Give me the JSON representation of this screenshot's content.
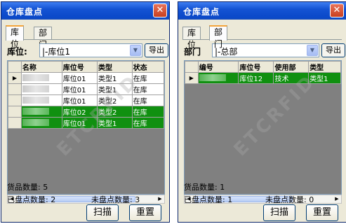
{
  "left": {
    "title": "仓库盘点",
    "close": "✕",
    "tabs": [
      "库位",
      "部门"
    ],
    "filter_label": "库位:",
    "combo_value": "|-库位1",
    "export": "导出",
    "columns": [
      "名称",
      "库位号",
      "类型",
      "状态"
    ],
    "rows": [
      {
        "loc": "库位01",
        "type": "类型1",
        "status": "在库"
      },
      {
        "loc": "库位01",
        "type": "类型1",
        "status": "在库"
      },
      {
        "loc": "库位01",
        "type": "类型2",
        "status": "在库"
      },
      {
        "loc": "库位02",
        "type": "类型2",
        "status": "在库"
      },
      {
        "loc": "库位01",
        "type": "类型1",
        "status": "在库"
      }
    ],
    "goods_count": "货品数量: 5",
    "checked": "已盘点数量: 2",
    "unchecked": "未盘点数量: 3",
    "scan": "扫描",
    "reset": "重置",
    "watermark": "ETCRFID"
  },
  "right": {
    "title": "仓库盘点",
    "close": "✕",
    "tabs": [
      "库位",
      "部门"
    ],
    "filter_label": "部门",
    "combo_value": "|-总部",
    "export": "导出",
    "columns": [
      "编号",
      "库位号",
      "使用部",
      "类型"
    ],
    "rows": [
      {
        "loc": "库位12",
        "dept": "技术",
        "type": "类型1"
      }
    ],
    "goods_count": "货品数量: 1",
    "checked": "已盘点数量: 1",
    "unchecked": "未盘点数量: 0",
    "scan": "扫描",
    "reset": "重置",
    "watermark": "ETCRFID"
  },
  "colors": {
    "title_bar": "#0a48c8",
    "selected_row": "#109010",
    "close": "#c9401f"
  }
}
